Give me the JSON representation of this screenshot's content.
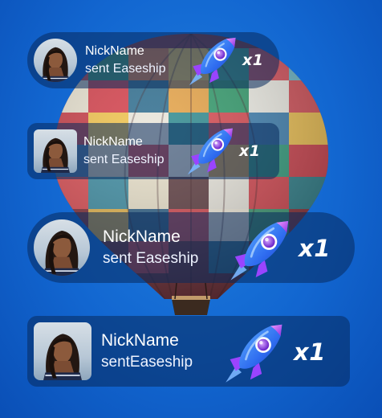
{
  "banners": [
    {
      "nickname": "NickName",
      "gift_text": "sent Easeship",
      "count": "x1",
      "avatar_shape": "circle"
    },
    {
      "nickname": "NickName",
      "gift_text": "sent Easeship",
      "count": "x1",
      "avatar_shape": "square"
    },
    {
      "nickname": "NickName",
      "gift_text": "sent Easeship",
      "count": "x1",
      "avatar_shape": "circle"
    },
    {
      "nickname": "NickName",
      "gift_text": "sentEaseship",
      "count": "x1",
      "avatar_shape": "square"
    }
  ],
  "icons": {
    "gift": "rocket-icon",
    "avatar": "user-avatar",
    "background": "hot-air-balloon"
  },
  "colors": {
    "background": "#1266d0",
    "banner": "#082a5c",
    "text": "#ffffff",
    "rocket_body": "#3a8dff",
    "rocket_accent": "#c04cff"
  }
}
